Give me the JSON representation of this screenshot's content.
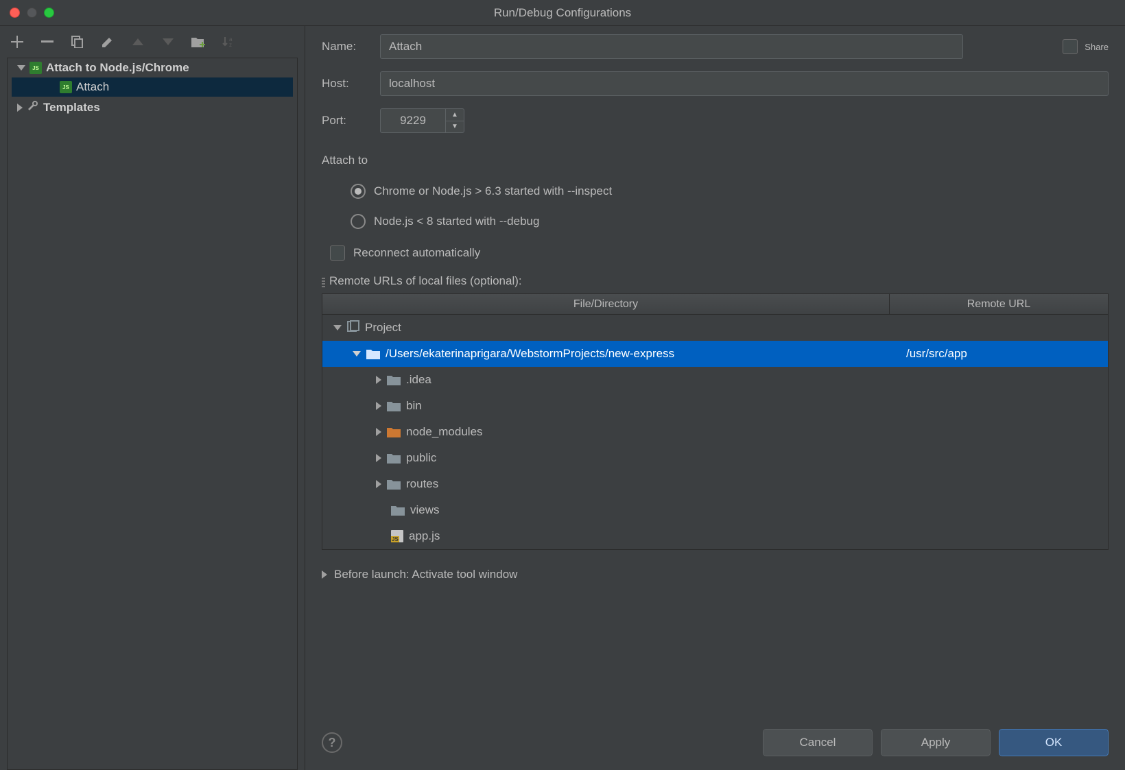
{
  "titlebar": {
    "title": "Run/Debug Configurations"
  },
  "toolbar": {
    "add": "+",
    "remove": "−",
    "copy": "⿻",
    "settings": "🔧",
    "up": "▲",
    "down": "▼"
  },
  "leftTree": {
    "group": "Attach to Node.js/Chrome",
    "item": "Attach",
    "templates": "Templates"
  },
  "form": {
    "nameLabel": "Name:",
    "nameValue": "Attach",
    "shareLabel": "Share",
    "hostLabel": "Host:",
    "hostValue": "localhost",
    "portLabel": "Port:",
    "portValue": "9229"
  },
  "attach": {
    "heading": "Attach to",
    "opt1": "Chrome or Node.js > 6.3 started with --inspect",
    "opt2": "Node.js < 8 started with --debug"
  },
  "reconnect": "Reconnect automatically",
  "remoteUrls": {
    "heading": "Remote URLs of local files (optional):",
    "col1": "File/Directory",
    "col2": "Remote URL"
  },
  "fileTree": {
    "project": "Project",
    "rootPath": "/Users/ekaterinaprigara/WebstormProjects/new-express",
    "rootRemote": "/usr/src/app",
    "children": [
      {
        "name": ".idea",
        "type": "folder",
        "expanded": false
      },
      {
        "name": "bin",
        "type": "folder",
        "expanded": false
      },
      {
        "name": "node_modules",
        "type": "folder-orange",
        "expanded": false
      },
      {
        "name": "public",
        "type": "folder",
        "expanded": false
      },
      {
        "name": "routes",
        "type": "folder",
        "expanded": false
      },
      {
        "name": "views",
        "type": "folder-leaf",
        "expanded": null
      },
      {
        "name": "app.js",
        "type": "file-js",
        "expanded": null
      }
    ]
  },
  "beforeLaunch": "Before launch: Activate tool window",
  "footer": {
    "cancel": "Cancel",
    "apply": "Apply",
    "ok": "OK"
  }
}
